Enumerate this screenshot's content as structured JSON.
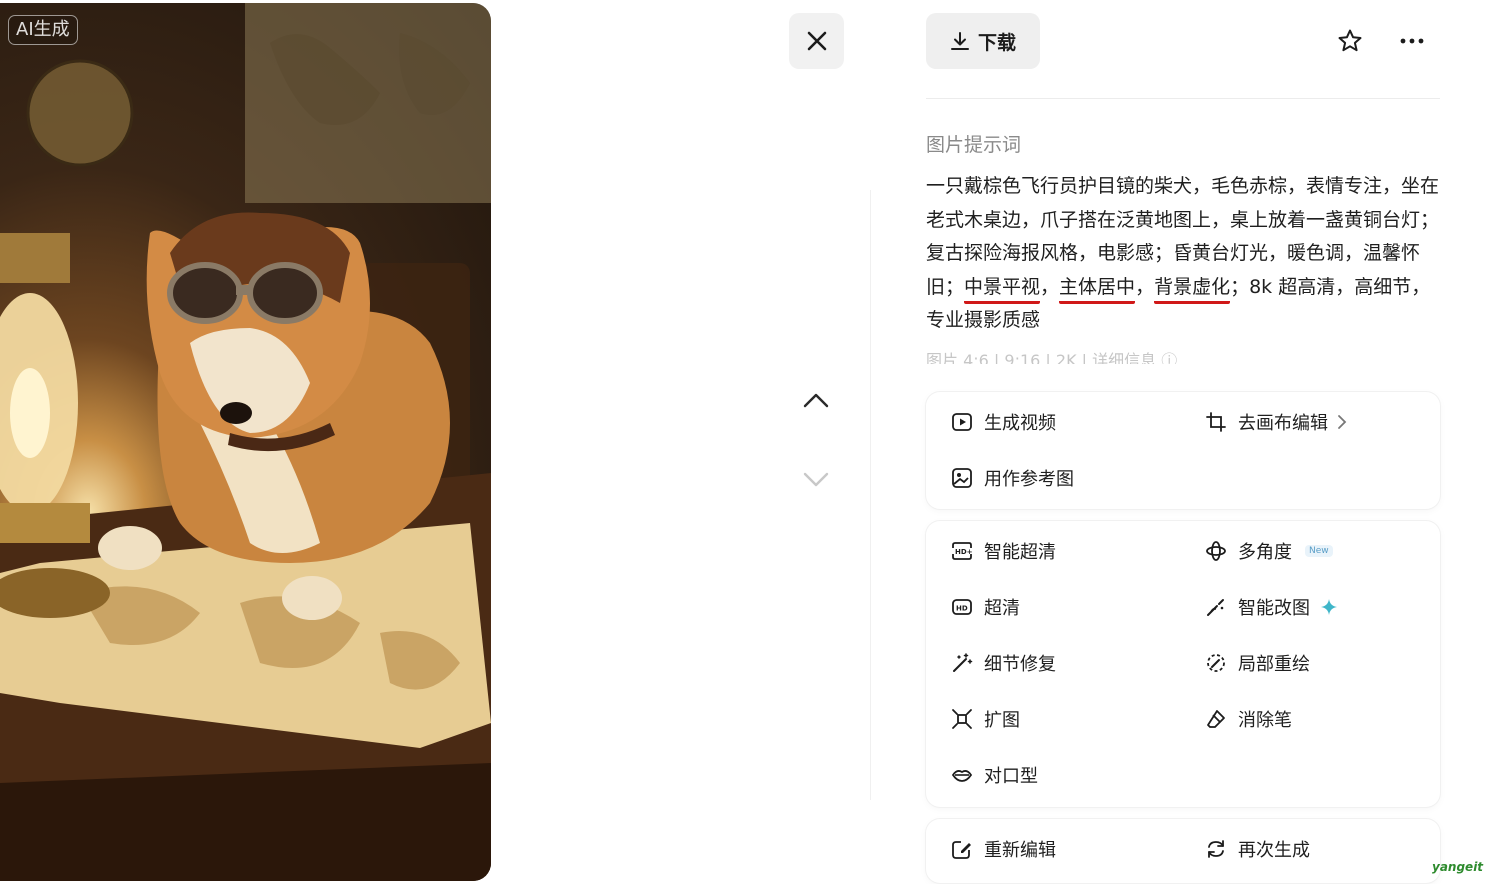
{
  "image": {
    "badge": "AI生成",
    "subject": "shiba-inu-pilot-goggles-map-lamp"
  },
  "controls": {
    "close_icon": "close-icon",
    "up_icon": "chevron-up-icon",
    "down_icon": "chevron-down-icon"
  },
  "toolbar": {
    "download_label": "下载",
    "download_icon": "download-icon",
    "star_icon": "star-icon",
    "more_icon": "more-icon"
  },
  "prompt": {
    "title": "图片提示词",
    "text_part1": "一只戴棕色飞行员护目镜的柴犬，毛色赤棕，表情专注，坐在老式木桌边，爪子搭在泛黄地图上，桌上放着一盏黄铜台灯；复古探险海报风格，电影感；昏黄台灯光，暖色调，温馨怀旧；",
    "underline1": "中景平视",
    "sep1": "，",
    "underline2": "主体居中",
    "sep2": "，",
    "underline3": "背景虚化",
    "text_part2": "；8k 超高清，高细节，专业摄影质感",
    "meta": "图片 4:6 | 9:16 | 2K | 详细信息 ⓘ",
    "underline_color": "#d01818"
  },
  "card1": {
    "generate_video": "生成视频",
    "canvas_edit": "去画布编辑",
    "use_as_reference": "用作参考图"
  },
  "card2": {
    "smart_hd": "智能超清",
    "multi_angle": "多角度",
    "multi_angle_badge": "New",
    "hd": "超清",
    "smart_edit": "智能改图",
    "detail_repair": "细节修复",
    "partial_redraw": "局部重绘",
    "expand": "扩图",
    "eraser": "消除笔",
    "lip_sync": "对口型"
  },
  "card3": {
    "re_edit": "重新编辑",
    "regenerate": "再次生成"
  },
  "watermark": "yangeit",
  "colors": {
    "accent_sparkle": "#3fb6c9",
    "badge_blue": "#5a9ec7"
  }
}
